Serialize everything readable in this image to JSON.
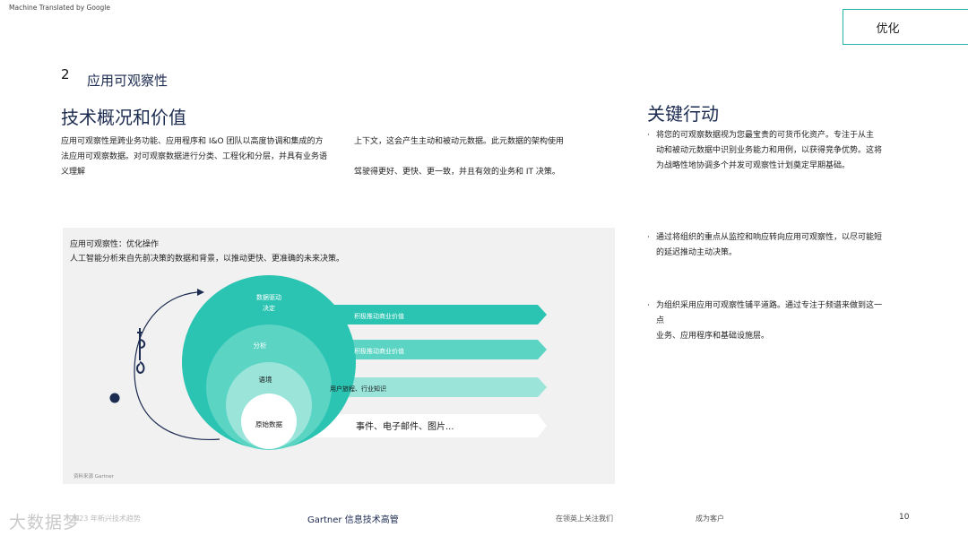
{
  "header": {
    "machine_translation_note": "Machine Translated by Google",
    "tab_label": "优化"
  },
  "section": {
    "number": "2",
    "title": "应用可观察性"
  },
  "overview": {
    "heading": "技术概况和价值",
    "paragraph_left": "应用可观察性是跨业务功能、应用程序和 I&O 团队以高度协调和集成的方法应用可观察数据。对可观察数据进行分类、工程化和分层，并具有业务语义理解",
    "paragraph_right_1": "上下文，这会产生主动和被动元数据。此元数据的架构使用",
    "paragraph_right_2": "驾驶得更好、更快、更一致，并且有效的业务和 IT 决策。"
  },
  "key_actions": {
    "heading": "关键行动",
    "bullet_marker": "·",
    "items": [
      {
        "line1": "将您的可观察数据视为您最宝贵的可货币化资产。专注于从主",
        "line2": "动和被动元数据中识别业务能力和用例，以获得竞争优势。这将",
        "line3": "为战略性地协调多个并发可观察性计划奠定早期基础。"
      },
      {
        "line1": "通过将组织的重点从监控和响应转向应用可观察性，以尽可能短",
        "line2": "的延迟推动主动决策。",
        "line3": ""
      },
      {
        "line1": "为组织采用应用可观察性铺平道路。通过专注于频谱来做到这一",
        "line2": "点",
        "line3": "业务、应用程序和基础设施层。"
      }
    ]
  },
  "figure": {
    "title": "应用可观察性：优化操作",
    "subtitle": "人工智能分析来自先前决策的数据和背景，以推动更快、更准确的未来决策。",
    "source": "资料来源 Gartner",
    "colors": {
      "layer1": "#2bc4b2",
      "layer2": "#5bd4c4",
      "layer3": "#9ae4da",
      "layer4": "#ffffff",
      "cycle": "#1c2b50"
    },
    "layers": [
      {
        "label": "数据驱动\n决定",
        "arrow_text": "积极推动商业价值"
      },
      {
        "label": "分析",
        "arrow_text": "积极推动商业价值"
      },
      {
        "label": "语境",
        "arrow_text": "用户旅程、行业知识"
      },
      {
        "label": "原始数据",
        "arrow_text": "事件、电子邮件、图片..."
      }
    ]
  },
  "footer": {
    "left": "2023 年新兴技术趋势",
    "center": "Gartner 信息技术高管",
    "link1": "在领英上关注我们",
    "link2": "成为客户",
    "page": "10"
  },
  "watermark": {
    "text": "大数据梦"
  }
}
